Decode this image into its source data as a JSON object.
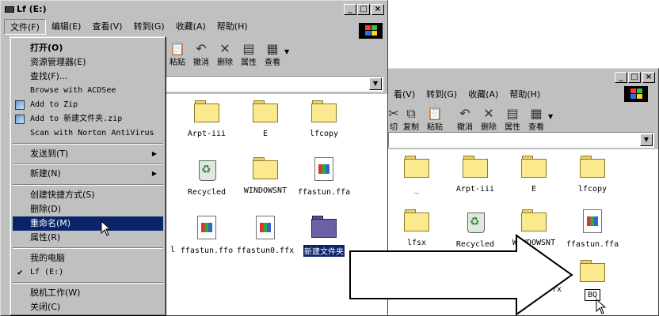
{
  "back_window": {
    "title": "Lf (E:)",
    "caption_buttons": [
      "_",
      "□",
      "×"
    ],
    "menu": [
      "文件(F)",
      "编辑(E)",
      "查看(V)",
      "转到(G)",
      "收藏(A)",
      "帮助(H)"
    ],
    "toolbar": [
      {
        "icon": "paste-icon",
        "label": "粘贴"
      },
      {
        "icon": "undo-icon",
        "label": "撤消"
      },
      {
        "icon": "delete-icon",
        "label": "删除"
      },
      {
        "icon": "properties-icon",
        "label": "属性"
      },
      {
        "icon": "views-icon",
        "label": "查看"
      }
    ],
    "files": [
      {
        "name": "Arpt-iii",
        "icon": "folder-icon"
      },
      {
        "name": "E",
        "icon": "folder-icon"
      },
      {
        "name": "lfcopy",
        "icon": "folder-icon"
      },
      {
        "name": "Recycled",
        "icon": "recycle-bin-icon"
      },
      {
        "name": "WINDOWSNT",
        "icon": "folder-icon"
      },
      {
        "name": "ffastun.ffa",
        "icon": "document-icon"
      },
      {
        "name": "l",
        "icon": "document-icon"
      },
      {
        "name": "ffastun.ffo",
        "icon": "document-icon"
      },
      {
        "name": "ffastun0.ffx",
        "icon": "document-icon"
      },
      {
        "name": "新建文件夹",
        "icon": "folder-icon"
      }
    ]
  },
  "context_menu": {
    "items": [
      {
        "label": "打开(O)",
        "bold": true
      },
      {
        "label": "资源管理器(E)"
      },
      {
        "label": "查找(F)..."
      },
      {
        "label": "Browse with ACDSee"
      },
      {
        "label": "Add to Zip"
      },
      {
        "label": "Add to 新建文件夹.zip"
      },
      {
        "label": "Scan with Norton AntiVirus"
      },
      {
        "label": "发送到(T)",
        "submenu": true
      },
      {
        "label": "新建(N)",
        "submenu": true
      },
      {
        "label": "创建快捷方式(S)"
      },
      {
        "label": "删除(D)"
      },
      {
        "label": "重命名(M)",
        "highlighted": true
      },
      {
        "label": "属性(R)"
      },
      {
        "label": "我的电脑"
      },
      {
        "label": "Lf (E:)",
        "checked": true
      },
      {
        "label": "脱机工作(W)"
      },
      {
        "label": "关闭(C)"
      }
    ]
  },
  "front_window": {
    "caption_buttons": [
      "_",
      "□",
      "×"
    ],
    "menu": [
      "看(V)",
      "转到(G)",
      "收藏(A)",
      "帮助(H)"
    ],
    "toolbar": [
      {
        "icon": "cut-icon",
        "label": "切"
      },
      {
        "icon": "copy-icon",
        "label": "复制"
      },
      {
        "icon": "paste-icon",
        "label": "粘贴"
      },
      {
        "icon": "undo-icon",
        "label": "撤消"
      },
      {
        "icon": "delete-icon",
        "label": "删除"
      },
      {
        "icon": "properties-icon",
        "label": "属性"
      },
      {
        "icon": "views-icon",
        "label": "查看"
      }
    ],
    "files": [
      {
        "name": "_",
        "icon": "folder-icon"
      },
      {
        "name": "Arpt-iii",
        "icon": "folder-icon"
      },
      {
        "name": "E",
        "icon": "folder-icon"
      },
      {
        "name": "lfcopy",
        "icon": "folder-icon"
      },
      {
        "name": "lfsx",
        "icon": "folder-icon"
      },
      {
        "name": "Recycled",
        "icon": "recycle-bin-icon"
      },
      {
        "name": "WINDOWSNT",
        "icon": "folder-icon"
      },
      {
        "name": "ffastun.ffa",
        "icon": "document-icon"
      },
      {
        "name": "ffx",
        "icon": "document-icon"
      },
      {
        "name": "BQ",
        "icon": "folder-icon"
      }
    ]
  },
  "colors": {
    "face": "#c0c0c0",
    "highlight": "#0a246a",
    "folder": "#fbe98e"
  }
}
